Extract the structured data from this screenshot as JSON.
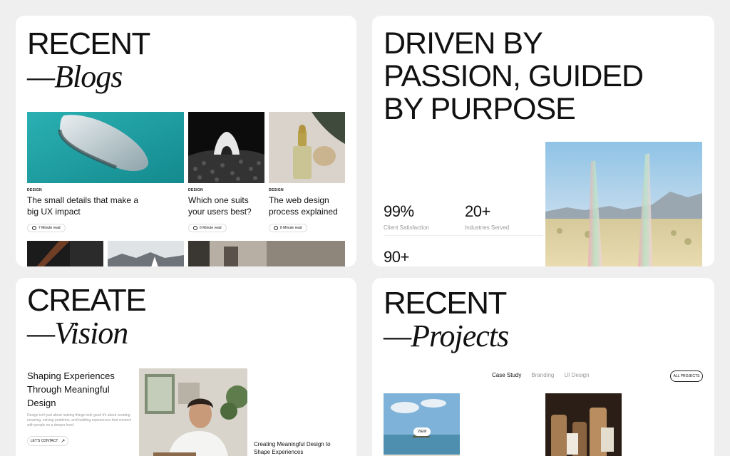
{
  "blogs": {
    "title_line1": "RECENT",
    "title_line2": "—Blogs",
    "posts": [
      {
        "tag": "DESIGN",
        "title": "The small details that make a big UX impact",
        "read": "7 Minute read"
      },
      {
        "tag": "DESIGN",
        "title": "Which one suits your users best?",
        "read": "6 Minute read"
      },
      {
        "tag": "DESIGN",
        "title": "The web design process explained",
        "read": "8 Minute read"
      }
    ]
  },
  "passion": {
    "headline": [
      "DRIVEN BY",
      "PASSION, GUIDED",
      "BY PURPOSE"
    ],
    "stats": [
      {
        "value": "99%",
        "label": "Client Satisfaction"
      },
      {
        "value": "20+",
        "label": "Industries Served"
      },
      {
        "value": "90+",
        "label": ""
      }
    ]
  },
  "vision": {
    "title_line1": "CREATE",
    "title_line2": "—Vision",
    "heading": "Shaping Experiences Through Meaningful Design",
    "paragraph": "Design isn't just about making things look good it's about creating meaning, solving problems, and building experiences that connect with people on a deeper level.",
    "contact_label": "LET'S CONTACT",
    "caption": "Creating Meaningful Design to Shape Experiences"
  },
  "projects": {
    "title_line1": "RECENT",
    "title_line2": "—Projects",
    "tabs": [
      "Case Study",
      "Branding",
      "UI Design"
    ],
    "active_tab": "Case Study",
    "all_label": "ALL PROJECTS",
    "view_label": "VIEW"
  }
}
